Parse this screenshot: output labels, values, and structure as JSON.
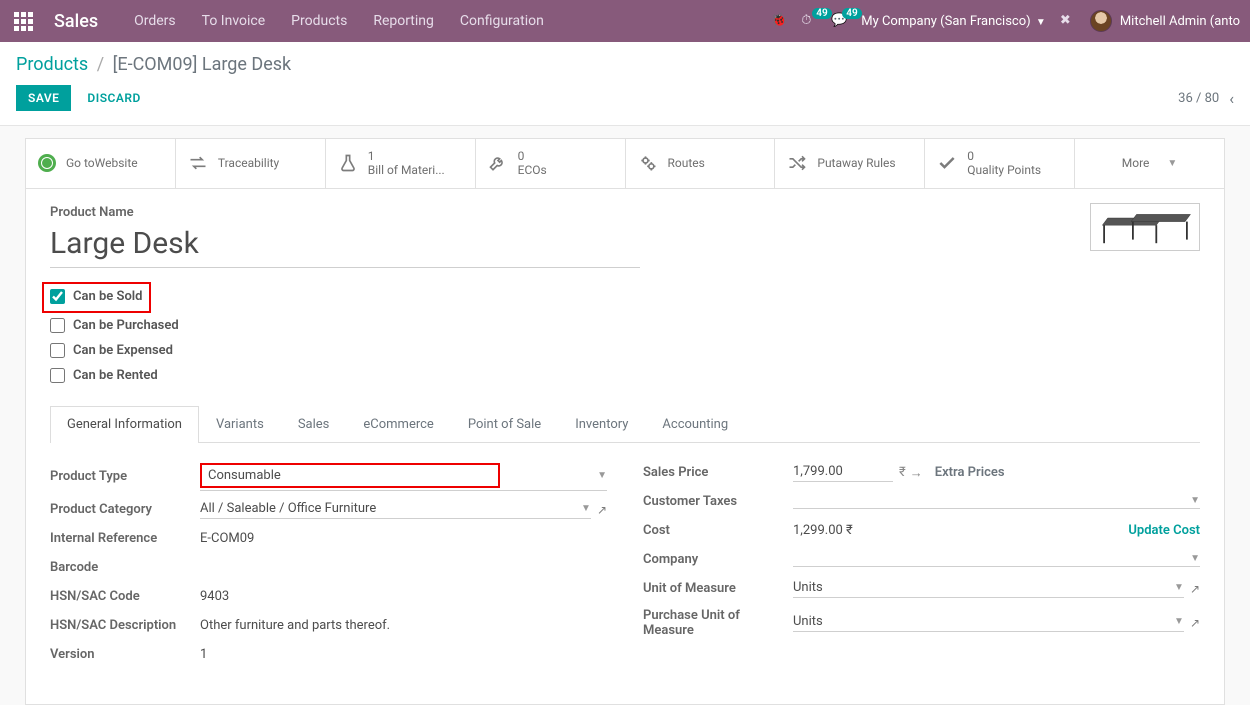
{
  "nav": {
    "brand": "Sales",
    "menu": [
      "Orders",
      "To Invoice",
      "Products",
      "Reporting",
      "Configuration"
    ],
    "badge1": "49",
    "badge2": "49",
    "company": "My Company (San Francisco)",
    "user": "Mitchell Admin (anto"
  },
  "breadcrumb": {
    "link": "Products",
    "current": "[E-COM09] Large Desk"
  },
  "actions": {
    "save": "SAVE",
    "discard": "DISCARD"
  },
  "pager": {
    "text": "36 / 80"
  },
  "stats": [
    {
      "label1": "Go to",
      "label2": "Website"
    },
    {
      "label1": "",
      "label2": "Traceability"
    },
    {
      "label1": "1",
      "label2": "Bill of Materi..."
    },
    {
      "label1": "0",
      "label2": "ECOs"
    },
    {
      "label1": "",
      "label2": "Routes"
    },
    {
      "label1": "",
      "label2": "Putaway Rules"
    },
    {
      "label1": "0",
      "label2": "Quality Points"
    },
    {
      "label1": "",
      "label2": "More"
    }
  ],
  "product": {
    "name_label": "Product Name",
    "name": "Large Desk",
    "checks": {
      "sold": "Can be Sold",
      "purchased": "Can be Purchased",
      "expensed": "Can be Expensed",
      "rented": "Can be Rented"
    }
  },
  "tabs": [
    "General Information",
    "Variants",
    "Sales",
    "eCommerce",
    "Point of Sale",
    "Inventory",
    "Accounting"
  ],
  "col1": {
    "type_l": "Product Type",
    "type_v": "Consumable",
    "cat_l": "Product Category",
    "cat_v": "All / Saleable / Office Furniture",
    "ref_l": "Internal Reference",
    "ref_v": "E-COM09",
    "bar_l": "Barcode",
    "bar_v": "",
    "hsn_l": "HSN/SAC Code",
    "hsn_v": "9403",
    "hsnd_l": "HSN/SAC Description",
    "hsnd_v": "Other furniture and parts thereof.",
    "ver_l": "Version",
    "ver_v": "1"
  },
  "col2": {
    "price_l": "Sales Price",
    "price_v": "1,799.00",
    "extra": "Extra Prices",
    "tax_l": "Customer Taxes",
    "cost_l": "Cost",
    "cost_v": "1,299.00 ₹",
    "update": "Update Cost",
    "comp_l": "Company",
    "uom_l": "Unit of Measure",
    "uom_v": "Units",
    "puom_l": "Purchase Unit of Measure",
    "puom_v": "Units"
  }
}
